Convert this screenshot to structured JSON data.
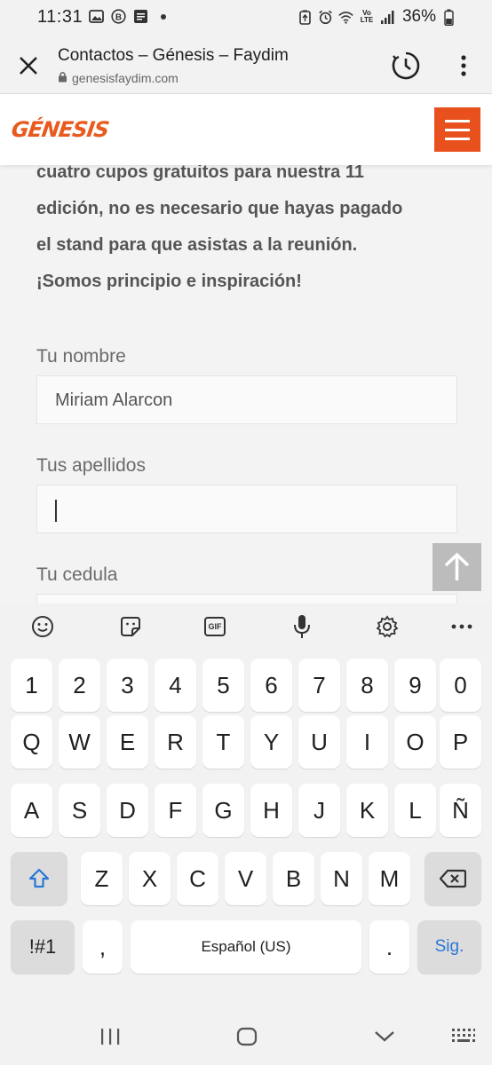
{
  "status_bar": {
    "time": "11:31",
    "left_icons": [
      "photo-icon",
      "b-app-icon",
      "notification-app-icon",
      "dot-icon"
    ],
    "right_icons": [
      "recycle-icon",
      "alarm-icon",
      "wifi-icon",
      "volte-icon",
      "signal-icon"
    ],
    "volte_text_top": "Vo",
    "volte_text_bottom": "LTE",
    "battery_percent": "36%"
  },
  "tab_header": {
    "title": "Contactos – Génesis – Faydim",
    "url": "genesisfaydim.com"
  },
  "site": {
    "logo": "GÉNESIS",
    "brand_color": "#e8501e"
  },
  "content": {
    "intro_lines": [
      "cuatro cupos gratuitos para nuestra 11",
      "edición, no es necesario que hayas pagado",
      "el stand para que asistas a la reunión.",
      "¡Somos principio e inspiración!"
    ],
    "fields": [
      {
        "label": "Tu nombre",
        "value": "Miriam Alarcon"
      },
      {
        "label": "Tus apellidos",
        "value": ""
      },
      {
        "label": "Tu cedula",
        "value": ""
      }
    ]
  },
  "keyboard": {
    "toolbar": [
      "emoji-icon",
      "sticker-icon",
      "gif-icon",
      "microphone-icon",
      "settings-icon",
      "more-icon"
    ],
    "gif_label": "GIF",
    "rows": [
      [
        "1",
        "2",
        "3",
        "4",
        "5",
        "6",
        "7",
        "8",
        "9",
        "0"
      ],
      [
        "Q",
        "W",
        "E",
        "R",
        "T",
        "Y",
        "U",
        "I",
        "O",
        "P"
      ],
      [
        "A",
        "S",
        "D",
        "F",
        "G",
        "H",
        "J",
        "K",
        "L",
        "Ñ"
      ],
      [
        "Z",
        "X",
        "C",
        "V",
        "B",
        "N",
        "M"
      ]
    ],
    "symbols_key": "!#1",
    "comma_key": ",",
    "space_label": "Español (US)",
    "period_key": ".",
    "action_key": "Sig.",
    "accent_color": "#2a77d6"
  },
  "nav_bar": {
    "icons": [
      "recent-apps-icon",
      "home-icon",
      "back-icon",
      "keyboard-hide-icon"
    ]
  }
}
